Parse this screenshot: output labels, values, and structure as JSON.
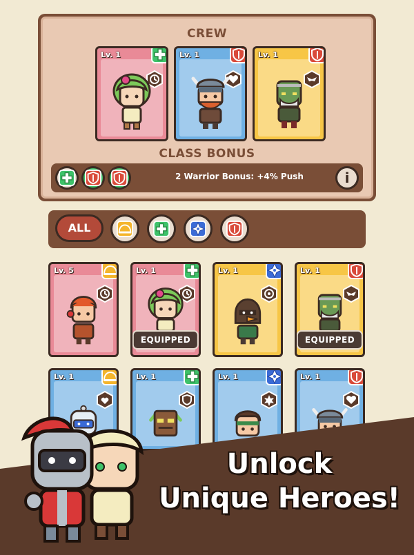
{
  "crew": {
    "title": "CREW",
    "bonus_title": "CLASS BONUS",
    "bonus_text": "2 Warrior Bonus: +4% Push",
    "info_label": "i",
    "cards": [
      {
        "level": "Lv. 1",
        "color": "pink",
        "class_icon": "plus-icon",
        "skill_icon": "clock-icon"
      },
      {
        "level": "Lv. 1",
        "color": "blue",
        "class_icon": "shield-icon",
        "skill_icon": "heart-icon"
      },
      {
        "level": "Lv. 1",
        "color": "yellow",
        "class_icon": "shield-icon",
        "skill_icon": "wings-icon"
      }
    ]
  },
  "filter": {
    "all_label": "ALL",
    "buttons": [
      "helmet-icon",
      "plus-icon",
      "shuriken-icon",
      "shield-icon"
    ]
  },
  "roster": {
    "equipped_label": "EQUIPPED",
    "cards": [
      {
        "level": "Lv. 5",
        "color": "pink"
      },
      {
        "level": "Lv. 1",
        "color": "pink",
        "equipped": true
      },
      {
        "level": "Lv. 1",
        "color": "yellow"
      },
      {
        "level": "Lv. 1",
        "color": "yellow",
        "equipped": true
      },
      {
        "level": "Lv. 1",
        "color": "blue"
      },
      {
        "level": "Lv. 1",
        "color": "blue"
      },
      {
        "level": "Lv. 1",
        "color": "blue"
      },
      {
        "level": "Lv. 1",
        "color": "blue"
      }
    ]
  },
  "banner": {
    "line1": "Unlock",
    "line2": "Unique Heroes!"
  },
  "colors": {
    "brown": "#7a4e37",
    "plus_green": "#3ec26a",
    "shield_red": "#d94a3a",
    "shuriken_blue": "#3b6bd6",
    "helmet_yellow": "#f4b52d"
  }
}
